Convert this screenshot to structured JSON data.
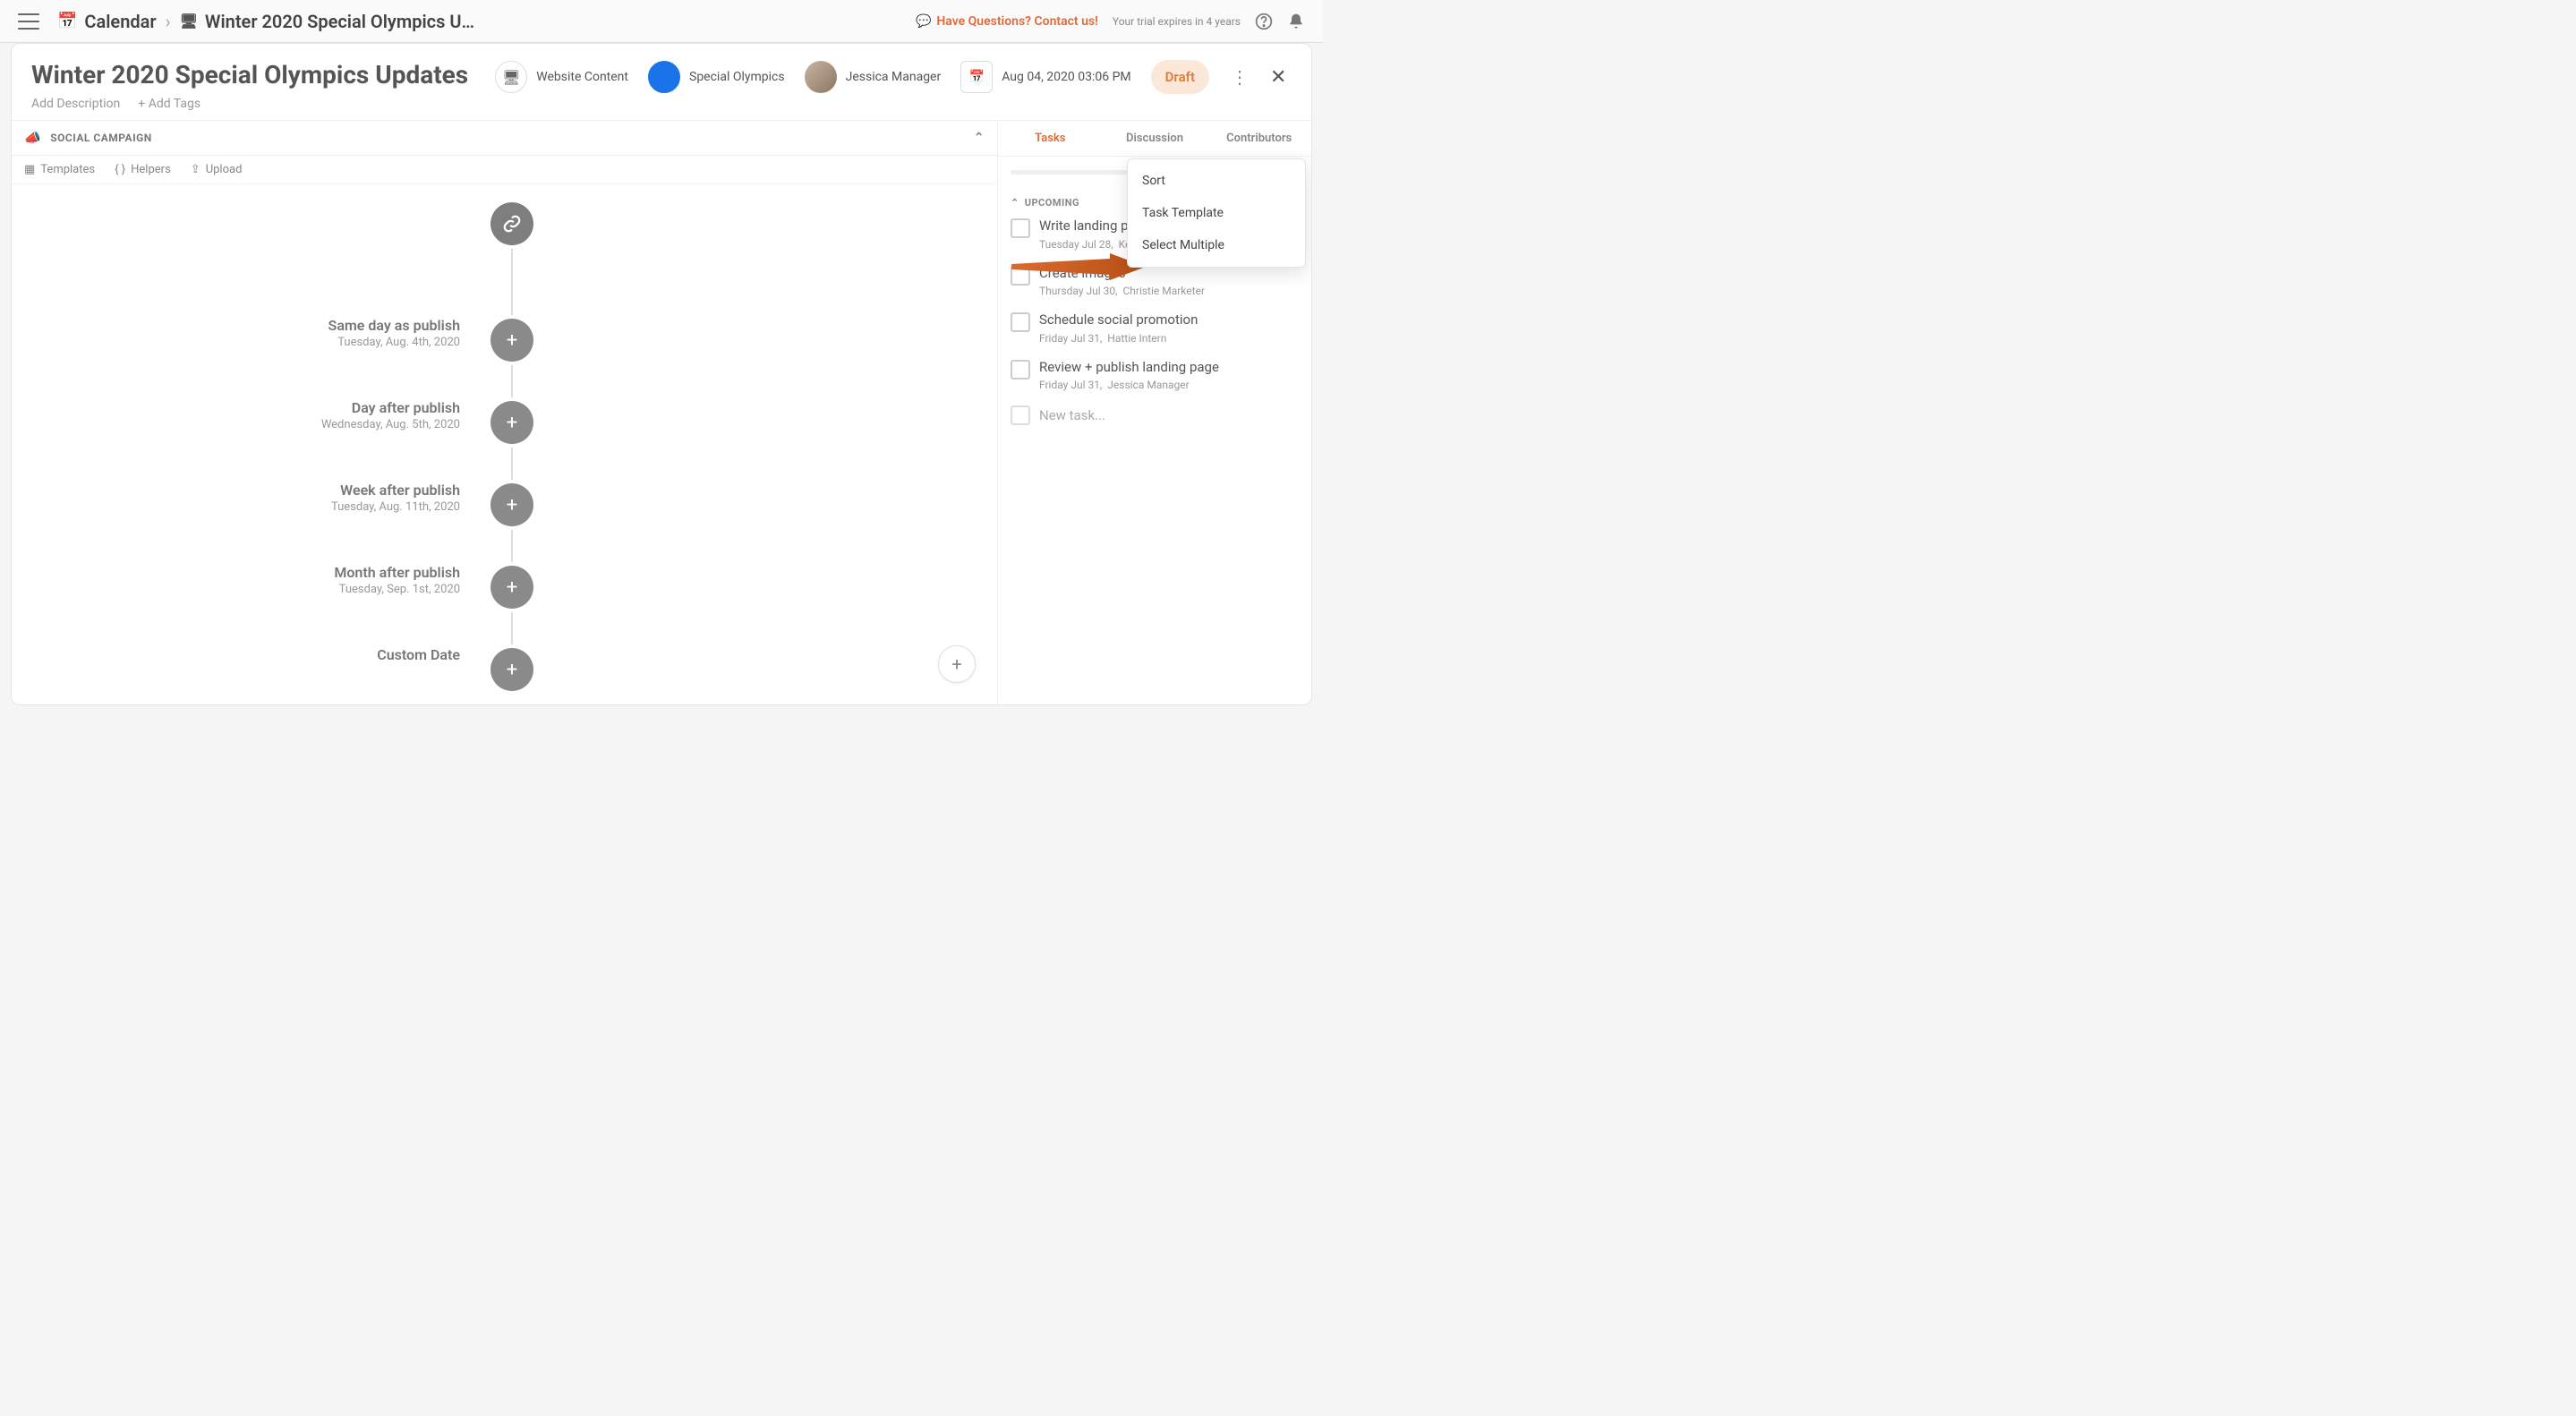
{
  "topbar": {
    "calendar_label": "Calendar",
    "page_title": "Winter 2020 Special Olympics U…",
    "contact_label": "Have Questions? Contact us!",
    "trial_label": "Your trial expires in 4 years"
  },
  "project": {
    "title": "Winter 2020 Special Olympics Updates",
    "add_description": "Add Description",
    "add_tags": "+ Add Tags",
    "chips": {
      "type_label": "Website Content",
      "category_label": "Special Olympics",
      "owner_label": "Jessica Manager",
      "date_label": "Aug 04, 2020 03:06 PM",
      "status_label": "Draft"
    }
  },
  "campaign_bar": {
    "label": "SOCIAL CAMPAIGN"
  },
  "mini_toolbar": {
    "templates": "Templates",
    "helpers": "Helpers",
    "upload": "Upload"
  },
  "timeline": {
    "rows": [
      {
        "heading": "Same day as publish",
        "date": "Tuesday, Aug. 4th, 2020"
      },
      {
        "heading": "Day after publish",
        "date": "Wednesday, Aug. 5th, 2020"
      },
      {
        "heading": "Week after publish",
        "date": "Tuesday, Aug. 11th, 2020"
      },
      {
        "heading": "Month after publish",
        "date": "Tuesday, Sep. 1st, 2020"
      },
      {
        "heading": "Custom Date",
        "date": ""
      }
    ]
  },
  "sidebar": {
    "tabs": {
      "tasks": "Tasks",
      "discussion": "Discussion",
      "contributors": "Contributors"
    },
    "progress_pct": "0%",
    "section_label": "UPCOMING",
    "tasks": [
      {
        "title": "Write landing page",
        "meta_date": "Tuesday Jul 28,",
        "meta_user": "Kels"
      },
      {
        "title": "Create images",
        "meta_date": "Thursday Jul 30,",
        "meta_user": "Christie Marketer"
      },
      {
        "title": "Schedule social promotion",
        "meta_date": "Friday Jul 31,",
        "meta_user": "Hattie Intern"
      },
      {
        "title": "Review + publish landing page",
        "meta_date": "Friday Jul 31,",
        "meta_user": "Jessica Manager"
      }
    ],
    "new_task_placeholder": "New task...",
    "menu": {
      "sort": "Sort",
      "template": "Task Template",
      "select_multiple": "Select Multiple"
    }
  }
}
